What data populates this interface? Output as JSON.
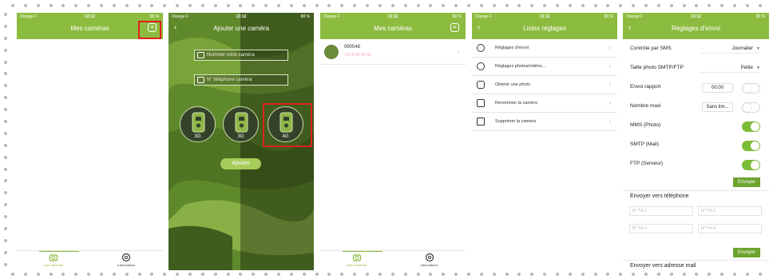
{
  "status_bar": {
    "carrier": "Orange F",
    "time": "13:12",
    "battery": "88 %"
  },
  "screen1": {
    "title": "Mes caméras",
    "add_icon": "plus-square-icon",
    "tabs": [
      {
        "label": "Liste caméras",
        "icon": "camera-icon"
      },
      {
        "label": "Informations",
        "icon": "gear-icon"
      }
    ]
  },
  "screen2": {
    "back": "‹",
    "title": "Ajouter une caméra",
    "name_placeholder": "Nommer votre caméra",
    "phone_placeholder": "N° téléphone caméra",
    "cameras": [
      {
        "label": "3G"
      },
      {
        "label": "3G"
      },
      {
        "label": "4G"
      }
    ],
    "add_button": "Ajouter"
  },
  "screen3": {
    "title": "Mes caméras",
    "camera_name": "990548",
    "camera_number": "+33 6 00 00 00",
    "tabs": [
      {
        "label": "Liste caméras"
      },
      {
        "label": "Informations"
      }
    ]
  },
  "screen4": {
    "back": "‹",
    "title": "Listes réglages",
    "items": [
      {
        "label": "Réglages d'envoi",
        "icon": "gear-icon"
      },
      {
        "label": "Réglages photos/vidéos...",
        "icon": "gear-icon"
      },
      {
        "label": "Obtenir une photo",
        "icon": "message-icon"
      },
      {
        "label": "Renommer la caméra",
        "icon": "user-icon"
      },
      {
        "label": "Supprimer la caméra",
        "icon": "trash-icon"
      }
    ]
  },
  "screen5": {
    "back": "‹",
    "title": "Réglages d'envoi",
    "rows": {
      "sms_label": "Contrôle par SMS",
      "sms_value": "Journalier",
      "size_label": "Taille photo SMTP/FTP",
      "size_value": "Petite",
      "report_label": "Envoi rapport",
      "report_time": "00:00",
      "max_label": "Nombre maxi",
      "max_value": "Sans lim...",
      "mms_label": "MMS (Photo)",
      "smtp_label": "SMTP (Mail)",
      "ftp_label": "FTP (Serveur)"
    },
    "toggles": {
      "report": false,
      "max": false,
      "mms": true,
      "smtp": true,
      "ftp": true
    },
    "send_button": "Envoyer",
    "phone_section": "Envoyer vers téléphone",
    "tel_placeholders": [
      "N° Tél 1",
      "N° Tél 2",
      "N° Tél 3",
      "N° Tél 4"
    ],
    "send_button2": "Envoyer",
    "mail_section": "Envoyer vers adresse mail"
  }
}
